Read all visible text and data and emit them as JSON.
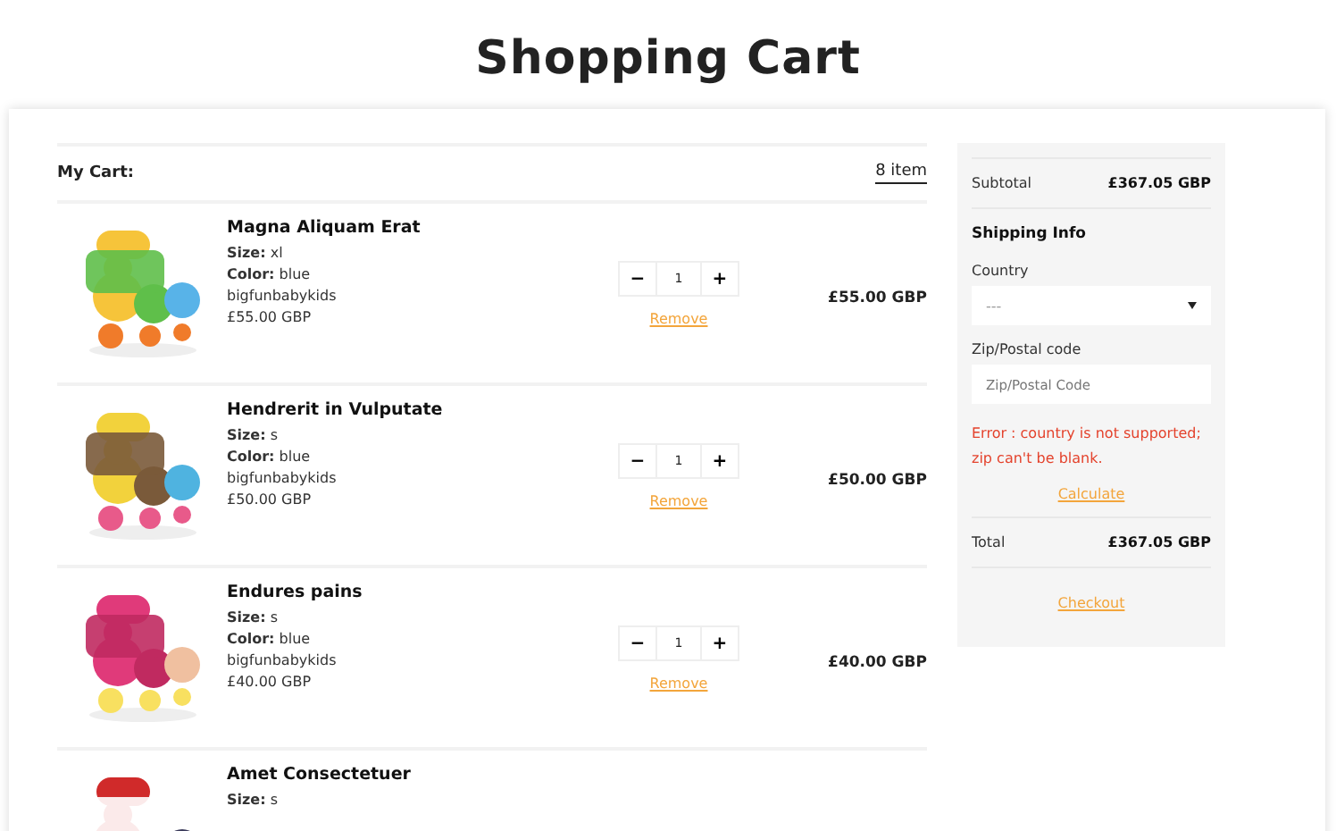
{
  "title": "Shopping Cart",
  "cart": {
    "heading": "My Cart:",
    "count": "8 item",
    "items": [
      {
        "name": "Magna Aliquam Erat",
        "size_label": "Size:",
        "size": "xl",
        "color_label": "Color:",
        "color_option": "blue",
        "vendor": "bigfunbabykids",
        "unit_price": "£55.00 GBP",
        "quantity": "1",
        "minus": "−",
        "plus": "+",
        "remove": "Remove",
        "line_total": "£55.00 GBP"
      },
      {
        "name": "Hendrerit in Vulputate",
        "size_label": "Size:",
        "size": "s",
        "color_label": "Color:",
        "color_option": "blue",
        "vendor": "bigfunbabykids",
        "unit_price": "£50.00 GBP",
        "quantity": "1",
        "minus": "−",
        "plus": "+",
        "remove": "Remove",
        "line_total": "£50.00 GBP"
      },
      {
        "name": "Endures pains",
        "size_label": "Size:",
        "size": "s",
        "color_label": "Color:",
        "color_option": "blue",
        "vendor": "bigfunbabykids",
        "unit_price": "£40.00 GBP",
        "quantity": "1",
        "minus": "−",
        "plus": "+",
        "remove": "Remove",
        "line_total": "£40.00 GBP"
      },
      {
        "name": "Amet Consectetuer",
        "size_label": "Size:",
        "size": "s"
      }
    ]
  },
  "summary": {
    "subtotal_label": "Subtotal",
    "subtotal": "£367.05 GBP",
    "shipping_heading": "Shipping Info",
    "country_label": "Country",
    "country_value": "---",
    "zip_label": "Zip/Postal code",
    "zip_placeholder": "Zip/Postal Code",
    "error": "Error : country is not supported; zip can't be blank.",
    "calculate": "Calculate",
    "total_label": "Total",
    "total": "£367.05 GBP",
    "checkout": "Checkout"
  }
}
